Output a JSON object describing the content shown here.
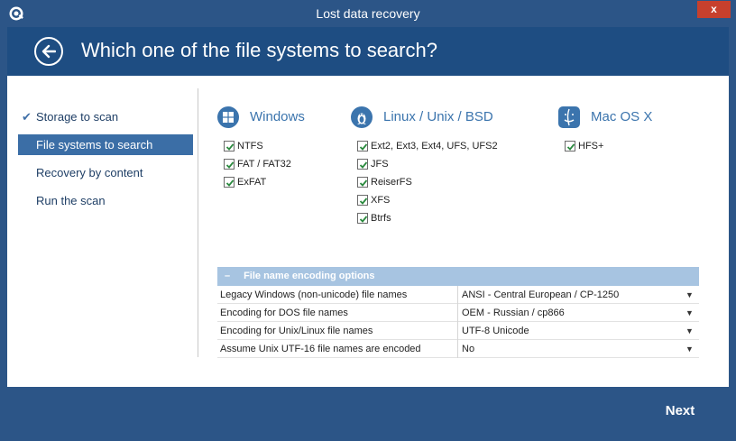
{
  "window": {
    "title": "Lost data recovery",
    "close_glyph": "x"
  },
  "header": {
    "title": "Which one of the file systems to search?"
  },
  "steps": [
    {
      "label": "Storage to scan",
      "done": true
    },
    {
      "label": "File systems to search",
      "active": true
    },
    {
      "label": "Recovery by content"
    },
    {
      "label": "Run the scan"
    }
  ],
  "filesystems": {
    "windows": {
      "name": "Windows",
      "icon": "windows-logo-icon",
      "items": [
        "NTFS",
        "FAT / FAT32",
        "ExFAT"
      ]
    },
    "linux": {
      "name": "Linux / Unix / BSD",
      "icon": "linux-penguin-icon",
      "items": [
        "Ext2, Ext3, Ext4, UFS, UFS2",
        "JFS",
        "ReiserFS",
        "XFS",
        "Btrfs"
      ]
    },
    "mac": {
      "name": "Mac OS X",
      "icon": "mac-finder-icon",
      "items": [
        "HFS+"
      ]
    }
  },
  "encoding": {
    "title": "File name encoding options",
    "collapse_glyph": "–",
    "rows": [
      {
        "label": "Legacy Windows (non-unicode) file names",
        "value": "ANSI - Central European / CP-1250"
      },
      {
        "label": "Encoding for DOS file names",
        "value": "OEM - Russian / cp866"
      },
      {
        "label": "Encoding for Unix/Linux file names",
        "value": "UTF-8 Unicode"
      },
      {
        "label": "Assume Unix UTF-16 file names are encoded",
        "value": "No"
      }
    ]
  },
  "footer": {
    "next_label": "Next"
  },
  "colors": {
    "accent": "#2c5587",
    "header": "#1e4d82",
    "active_step": "#3b6ea6",
    "fs_title": "#3b74ad",
    "enc_head": "#a7c4e1",
    "close": "#c7402d"
  }
}
